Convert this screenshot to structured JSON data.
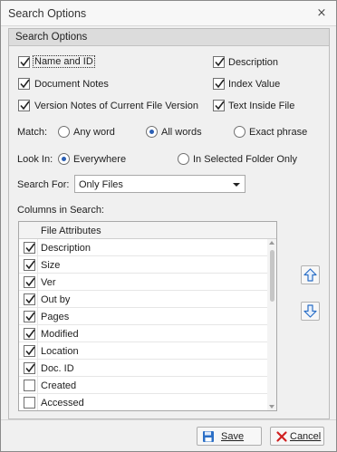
{
  "window": {
    "title": "Search Options",
    "close_glyph": "⨯"
  },
  "group": {
    "title": "Search Options"
  },
  "search_in": {
    "name_and_id": {
      "label": "Name and ID",
      "checked": true
    },
    "description": {
      "label": "Description",
      "checked": true
    },
    "document_notes": {
      "label": "Document Notes",
      "checked": true
    },
    "index_value": {
      "label": "Index Value",
      "checked": true
    },
    "version_notes": {
      "label": "Version Notes of Current File Version",
      "checked": true
    },
    "text_inside_file": {
      "label": "Text Inside File",
      "checked": true
    }
  },
  "match": {
    "label": "Match:",
    "options": [
      "Any word",
      "All words",
      "Exact phrase"
    ],
    "selected": "All words"
  },
  "look_in": {
    "label": "Look In:",
    "options": [
      "Everywhere",
      "In Selected Folder Only"
    ],
    "selected": "Everywhere"
  },
  "search_for": {
    "label": "Search For:",
    "value": "Only Files"
  },
  "columns": {
    "label": "Columns in Search:",
    "header": "File Attributes",
    "rows": [
      {
        "label": "Description",
        "checked": true
      },
      {
        "label": "Size",
        "checked": true
      },
      {
        "label": "Ver",
        "checked": true
      },
      {
        "label": "Out by",
        "checked": true
      },
      {
        "label": "Pages",
        "checked": true
      },
      {
        "label": "Modified",
        "checked": true
      },
      {
        "label": "Location",
        "checked": true
      },
      {
        "label": "Doc. ID",
        "checked": true
      },
      {
        "label": "Created",
        "checked": false
      },
      {
        "label": "Accessed",
        "checked": false
      }
    ]
  },
  "buttons": {
    "save": "Save",
    "cancel": "Cancel"
  },
  "icons": {
    "close": "close-icon",
    "move_up": "arrow-up-icon",
    "move_down": "arrow-down-icon",
    "save": "floppy-disk-icon",
    "cancel": "red-x-icon",
    "check": "checkmark-icon"
  },
  "colors": {
    "accent_blue": "#2b6fc6",
    "cancel_red": "#d02020",
    "radio_dot": "#2b5fb4"
  }
}
